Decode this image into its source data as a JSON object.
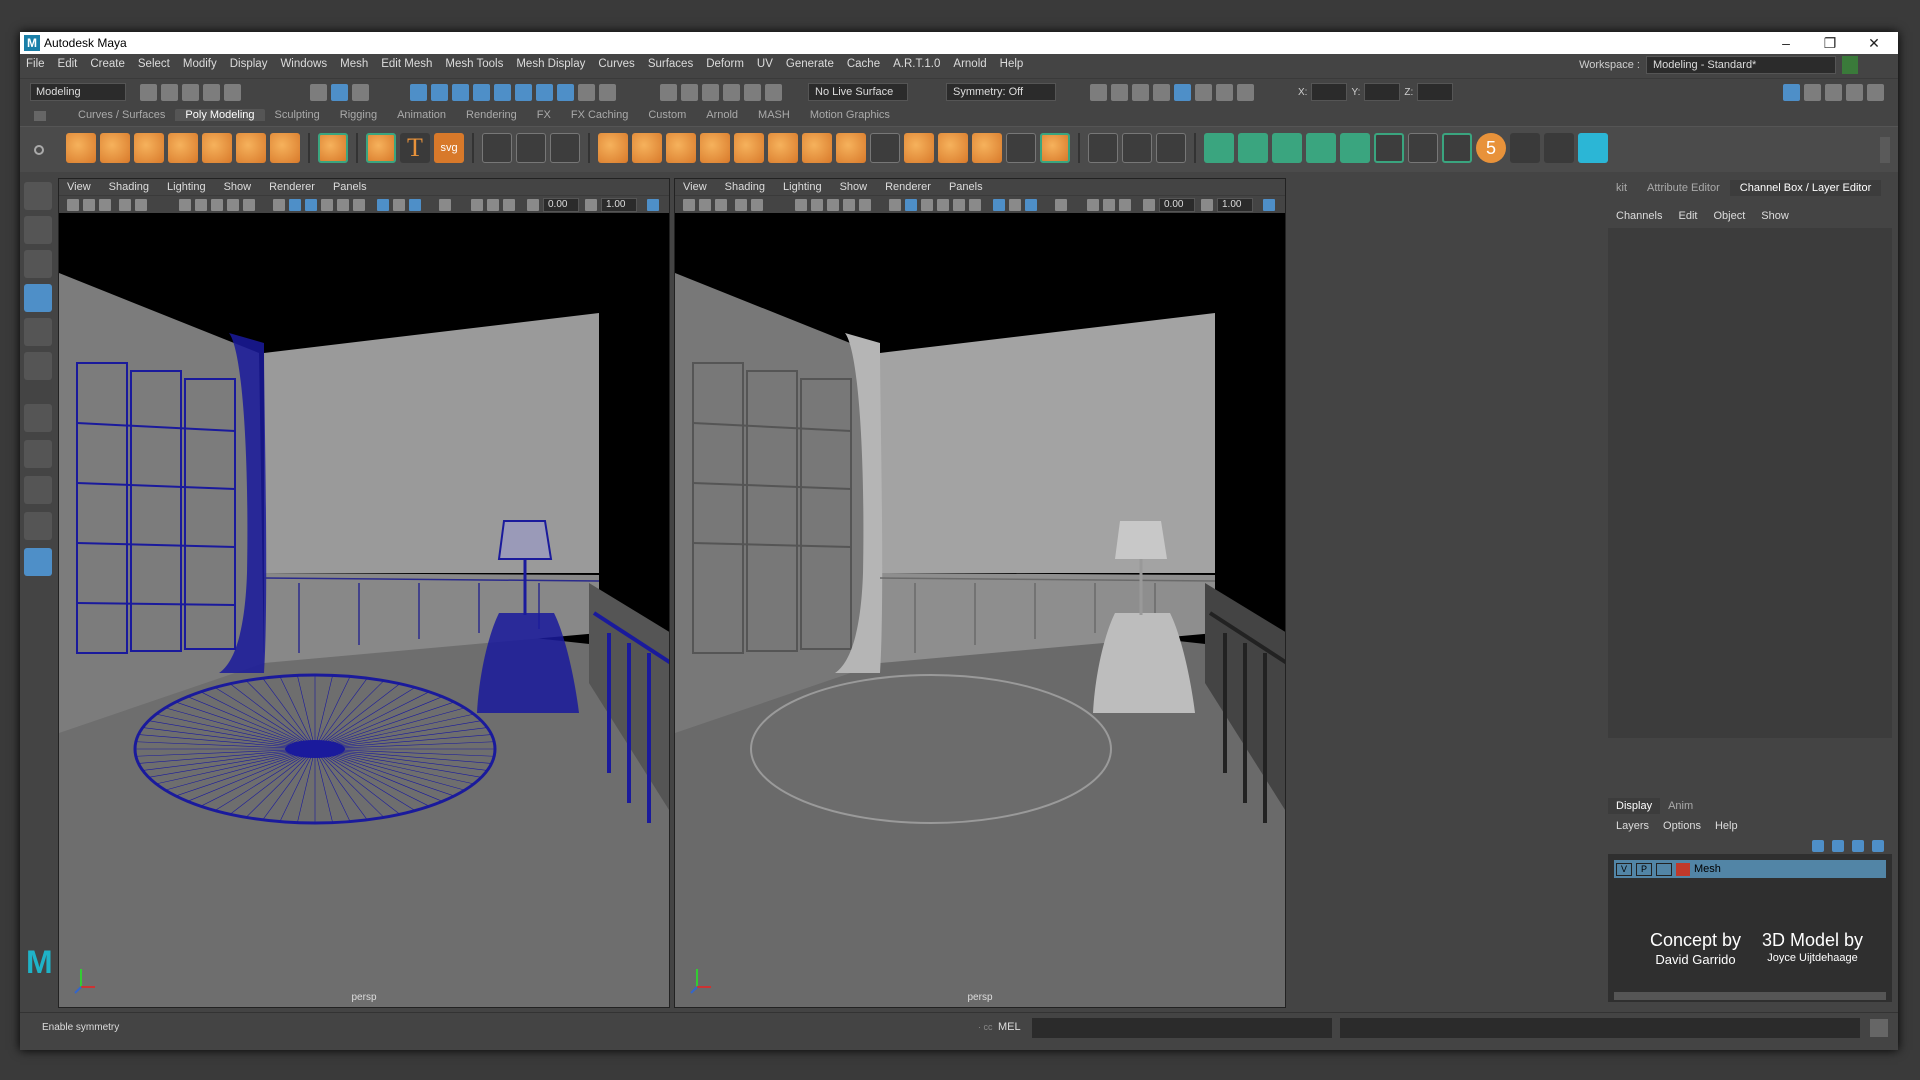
{
  "window": {
    "title": "Autodesk Maya",
    "logo_letter": "M",
    "minimize": "–",
    "restore": "❐",
    "close": "✕"
  },
  "menubar": {
    "items": [
      "File",
      "Edit",
      "Create",
      "Select",
      "Modify",
      "Display",
      "Windows",
      "Mesh",
      "Edit Mesh",
      "Mesh Tools",
      "Mesh Display",
      "Curves",
      "Surfaces",
      "Deform",
      "UV",
      "Generate",
      "Cache",
      "A.R.T.1.0",
      "Arnold",
      "Help"
    ],
    "workspace_label": "Workspace :",
    "workspace_value": "Modeling - Standard*"
  },
  "statusline": {
    "mode": "Modeling",
    "live_surface": "No Live Surface",
    "symmetry": "Symmetry: Off",
    "x_label": "X:",
    "y_label": "Y:",
    "z_label": "Z:"
  },
  "shelf_tabs": [
    "Curves / Surfaces",
    "Poly Modeling",
    "Sculpting",
    "Rigging",
    "Animation",
    "Rendering",
    "FX",
    "FX Caching",
    "Custom",
    "Arnold",
    "MASH",
    "Motion Graphics"
  ],
  "shelf_active": "Poly Modeling",
  "shelf_text_icons": {
    "text": "T",
    "svg": "svg",
    "five": "5"
  },
  "viewport_left": {
    "menu": [
      "View",
      "Shading",
      "Lighting",
      "Show",
      "Renderer",
      "Panels"
    ],
    "field1": "0.00",
    "field2": "1.00",
    "camera": "persp",
    "mode": "wireframe-on-shaded"
  },
  "viewport_right": {
    "menu": [
      "View",
      "Shading",
      "Lighting",
      "Show",
      "Renderer",
      "Panels"
    ],
    "field1": "0.00",
    "field2": "1.00",
    "camera": "persp",
    "mode": "smooth-shaded"
  },
  "right_panel": {
    "tabs": [
      "kit",
      "Attribute Editor",
      "Channel Box / Layer Editor"
    ],
    "active_tab": "Channel Box / Layer Editor",
    "menu": [
      "Channels",
      "Edit",
      "Object",
      "Show"
    ],
    "layer_tabs": [
      "Display",
      "Anim"
    ],
    "layer_menu": [
      "Layers",
      "Options",
      "Help"
    ],
    "layer": {
      "v": "V",
      "p": "P",
      "name": "Mesh",
      "color": "#c0392b"
    }
  },
  "credits": {
    "concept_title": "Concept by",
    "concept_name": "David Garrido",
    "model_title": "3D Model by",
    "model_name": "Joyce Uijtdehaage"
  },
  "commandline": {
    "hint": "Enable symmetry",
    "ellipsis": "· cc",
    "language": "MEL"
  },
  "colors": {
    "accent": "#4e8fc8",
    "shelf_orange": "#e8923a",
    "wire_blue": "#1a1a9c",
    "maya_cyan": "#1fb3c7"
  }
}
